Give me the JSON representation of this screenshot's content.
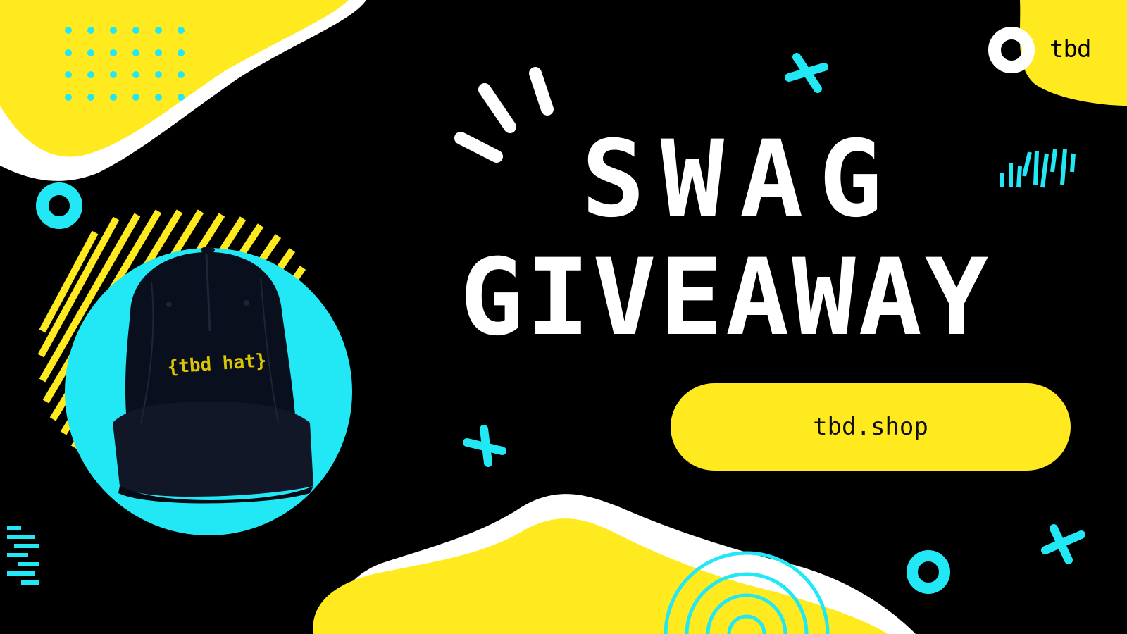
{
  "brand": {
    "logo_text": "tbd"
  },
  "headline": {
    "line1": "SWAG",
    "line2": "GIVEAWAY"
  },
  "cta": {
    "label": "tbd.shop"
  },
  "product": {
    "embroidery": "{tbd hat}"
  },
  "colors": {
    "background": "#000000",
    "yellow": "#ffea1f",
    "cyan": "#22e8f5",
    "white": "#ffffff"
  },
  "icons": [
    "ring-logo-icon",
    "plus-icon",
    "dot-grid-icon",
    "stripe-pattern-icon",
    "wave-lines-icon",
    "concentric-arcs-icon",
    "circle-ring-icon",
    "burst-lines-icon"
  ]
}
